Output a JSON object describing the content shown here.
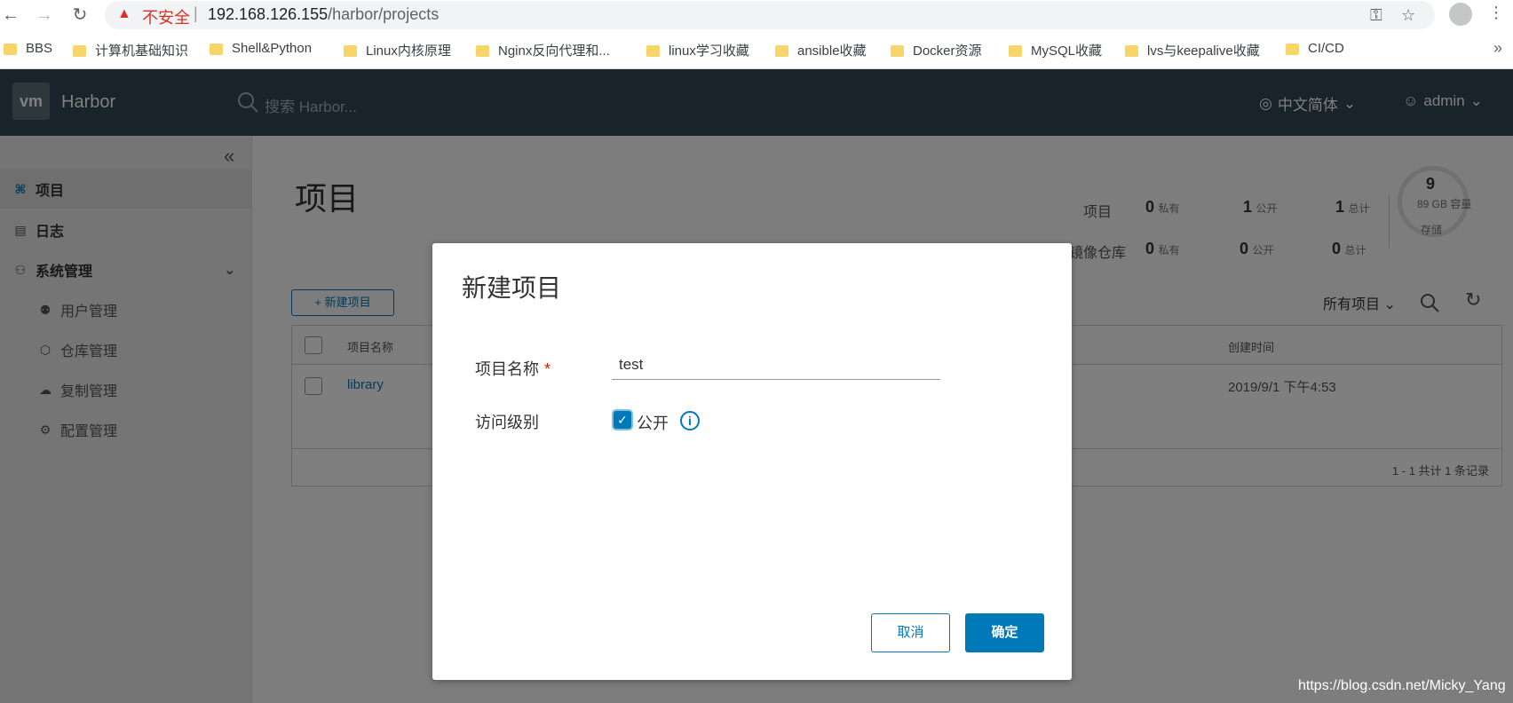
{
  "browser": {
    "insecure_label": "不安全",
    "separator": "|",
    "url_host": "192.168.126.155",
    "url_path": "/harbor/projects",
    "bookmarks": [
      "BBS",
      "计算机基础知识",
      "Shell&Python",
      "Linux内核原理",
      "Nginx反向代理和...",
      "linux学习收藏",
      "ansible收藏",
      "Docker资源",
      "MySQL收藏",
      "lvs与keepalive收藏",
      "CI/CD"
    ],
    "more": "»"
  },
  "header": {
    "logo": "vm",
    "app_name": "Harbor",
    "search_placeholder": "搜索 Harbor...",
    "language": "中文简体",
    "user": "admin"
  },
  "sidebar": {
    "items": [
      {
        "label": "项目"
      },
      {
        "label": "日志"
      },
      {
        "label": "系统管理"
      },
      {
        "label": "用户管理"
      },
      {
        "label": "仓库管理"
      },
      {
        "label": "复制管理"
      },
      {
        "label": "配置管理"
      }
    ]
  },
  "main": {
    "title": "项目",
    "stats": {
      "row1_label": "项目",
      "row2_label": "镜像仓库",
      "row1": [
        {
          "num": "0",
          "unit": "私有"
        },
        {
          "num": "1",
          "unit": "公开"
        },
        {
          "num": "1",
          "unit": "总计"
        }
      ],
      "row2": [
        {
          "num": "0",
          "unit": "私有"
        },
        {
          "num": "0",
          "unit": "公开"
        },
        {
          "num": "0",
          "unit": "总计"
        }
      ],
      "quota_num": "9",
      "quota_size": "89 GB 容量",
      "quota_label": "存储"
    },
    "new_project_button": "+ 新建项目",
    "filter": "所有项目",
    "table": {
      "headers": [
        "项目名称",
        "创建时间"
      ],
      "rows": [
        {
          "name": "library",
          "created": "2019/9/1 下午4:53"
        }
      ],
      "footer": "1 - 1 共计 1 条记录"
    }
  },
  "modal": {
    "title": "新建项目",
    "name_label": "项目名称",
    "required_mark": "*",
    "name_value": "test",
    "access_label": "访问级别",
    "public_label": "公开",
    "public_checked": true,
    "cancel_button": "取消",
    "ok_button": "确定"
  },
  "watermark": "https://blog.csdn.net/Micky_Yang",
  "colors": {
    "primary": "#0079b8",
    "header_bg": "#314754",
    "danger": "#d93025"
  }
}
